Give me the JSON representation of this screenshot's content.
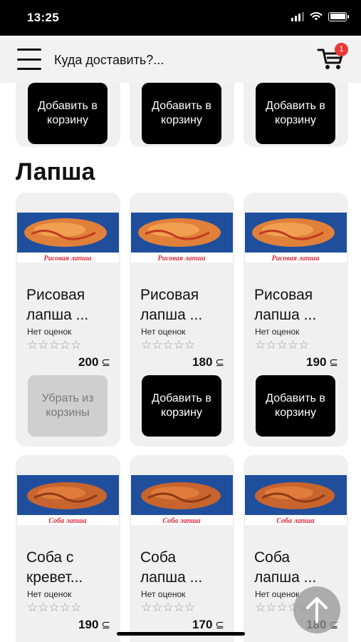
{
  "status_bar": {
    "time": "13:25"
  },
  "header": {
    "address_placeholder": "Куда доставить?...",
    "cart_count": "1"
  },
  "top_row": [
    {
      "button": "Добавить в корзину"
    },
    {
      "button": "Добавить в корзину"
    },
    {
      "button": "Добавить в корзину"
    }
  ],
  "section": {
    "title": "Лапша"
  },
  "products": [
    {
      "name": "Рисовая\nлапша ...",
      "photo_caption": "Рисовая лапша",
      "rating": "Нет оценок",
      "price": "200",
      "currency": "⊆",
      "button": "Убрать из корзины",
      "in_cart": true,
      "stars": "☆☆☆☆☆"
    },
    {
      "name": "Рисовая\nлапша ...",
      "photo_caption": "Рисовая лапша",
      "rating": "Нет оценок",
      "price": "180",
      "currency": "⊆",
      "button": "Добавить в корзину",
      "in_cart": false,
      "stars": "☆☆☆☆☆"
    },
    {
      "name": "Рисовая\nлапша ...",
      "photo_caption": "Рисовая лапша",
      "rating": "Нет оценок",
      "price": "190",
      "currency": "⊆",
      "button": "Добавить в корзину",
      "in_cart": false,
      "stars": "☆☆☆☆☆"
    },
    {
      "name": "Соба с\nкревет...",
      "photo_caption": "Соба лапша",
      "rating": "Нет оценок",
      "price": "190",
      "currency": "⊆",
      "stars": "☆☆☆☆☆"
    },
    {
      "name": "Соба\nлапша ...",
      "photo_caption": "Соба лапша",
      "rating": "Нет оценок",
      "price": "170",
      "currency": "⊆",
      "stars": "☆☆☆☆☆"
    },
    {
      "name": "Соба\nлапша ...",
      "photo_caption": "Соба лапша",
      "rating": "Нет оценок",
      "price": "180",
      "currency": "⊆",
      "stars": "☆☆☆☆☆"
    }
  ],
  "colors": {
    "accent": "#000000",
    "badge": "#e53935",
    "card": "#f0f0f0",
    "caption_red": "#d8283a",
    "tray_blue": "#1f4f9c"
  }
}
